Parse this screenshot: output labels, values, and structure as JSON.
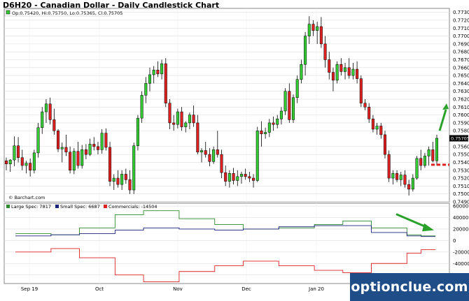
{
  "window": {
    "title": "D6H20 - Canadian Dollar - Daily Candlestick Chart"
  },
  "watermark": "optionclue.com",
  "chart_data": [
    {
      "type": "candlestick",
      "ohlc_legend": "Op:0.75420, Hi:0.75750, Lo:0.75365, Cl:0.75705",
      "credit": "© Barchart.com",
      "y_ticks": [
        "0.77300",
        "0.77200",
        "0.77100",
        "0.77000",
        "0.76900",
        "0.76800",
        "0.76700",
        "0.76600",
        "0.76500",
        "0.76400",
        "0.76300",
        "0.76200",
        "0.76100",
        "0.76000",
        "0.75900",
        "0.75800",
        "0.75600",
        "0.75500",
        "0.75400",
        "0.75300",
        "0.75200",
        "0.75100",
        "0.75000",
        "0.74900"
      ],
      "ylim": [
        0.749,
        0.7735
      ],
      "last_price_label": "0.75705",
      "last_price": 0.75705,
      "colors": {
        "up": "#33cc33",
        "down": "#e02020",
        "outline": "#000000"
      },
      "candles": [
        [
          0.7542,
          0.7546,
          0.753,
          0.7538
        ],
        [
          0.7538,
          0.7544,
          0.7528,
          0.7543
        ],
        [
          0.7543,
          0.7573,
          0.7535,
          0.7561
        ],
        [
          0.7561,
          0.7572,
          0.754,
          0.7546
        ],
        [
          0.7546,
          0.7556,
          0.753,
          0.7536
        ],
        [
          0.7536,
          0.7542,
          0.7526,
          0.7539
        ],
        [
          0.7539,
          0.7545,
          0.7522,
          0.753
        ],
        [
          0.753,
          0.7556,
          0.7526,
          0.7552
        ],
        [
          0.7552,
          0.759,
          0.7546,
          0.7584
        ],
        [
          0.7584,
          0.761,
          0.7576,
          0.7604
        ],
        [
          0.7604,
          0.762,
          0.759,
          0.7614
        ],
        [
          0.7614,
          0.7622,
          0.7588,
          0.7594
        ],
        [
          0.7594,
          0.7608,
          0.7575,
          0.758
        ],
        [
          0.758,
          0.7582,
          0.7553,
          0.7557
        ],
        [
          0.7557,
          0.7565,
          0.754,
          0.7559
        ],
        [
          0.7559,
          0.7575,
          0.7548,
          0.7553
        ],
        [
          0.7553,
          0.756,
          0.7526,
          0.753
        ],
        [
          0.753,
          0.7558,
          0.7525,
          0.7554
        ],
        [
          0.7554,
          0.7566,
          0.7532,
          0.7536
        ],
        [
          0.7536,
          0.7562,
          0.7532,
          0.7556
        ],
        [
          0.7556,
          0.7563,
          0.7544,
          0.755
        ],
        [
          0.755,
          0.757,
          0.7548,
          0.7563
        ],
        [
          0.7563,
          0.7572,
          0.7555,
          0.756
        ],
        [
          0.756,
          0.7566,
          0.755,
          0.7556
        ],
        [
          0.7556,
          0.7582,
          0.7551,
          0.7577
        ],
        [
          0.7577,
          0.7583,
          0.7555,
          0.7559
        ],
        [
          0.7559,
          0.7566,
          0.751,
          0.7516
        ],
        [
          0.7516,
          0.7525,
          0.7505,
          0.752
        ],
        [
          0.752,
          0.753,
          0.7508,
          0.7512
        ],
        [
          0.7512,
          0.753,
          0.7505,
          0.7525
        ],
        [
          0.7525,
          0.7532,
          0.7513,
          0.7518
        ],
        [
          0.7518,
          0.753,
          0.75,
          0.7505
        ],
        [
          0.7505,
          0.7565,
          0.75,
          0.7561
        ],
        [
          0.7561,
          0.76,
          0.7555,
          0.7596
        ],
        [
          0.7596,
          0.763,
          0.759,
          0.7625
        ],
        [
          0.7625,
          0.7648,
          0.7615,
          0.764
        ],
        [
          0.764,
          0.766,
          0.763,
          0.7651
        ],
        [
          0.7651,
          0.7662,
          0.764,
          0.7657
        ],
        [
          0.7657,
          0.7668,
          0.7648,
          0.7652
        ],
        [
          0.7652,
          0.767,
          0.7645,
          0.7665
        ],
        [
          0.7665,
          0.7672,
          0.761,
          0.7615
        ],
        [
          0.7615,
          0.762,
          0.7582,
          0.759
        ],
        [
          0.759,
          0.76,
          0.758,
          0.7588
        ],
        [
          0.7588,
          0.7608,
          0.7583,
          0.7604
        ],
        [
          0.7604,
          0.761,
          0.758,
          0.7585
        ],
        [
          0.7585,
          0.7592,
          0.7578,
          0.759
        ],
        [
          0.759,
          0.7603,
          0.7582,
          0.76
        ],
        [
          0.76,
          0.7612,
          0.7585,
          0.759
        ],
        [
          0.759,
          0.76,
          0.755,
          0.7553
        ],
        [
          0.7553,
          0.7558,
          0.754,
          0.7555
        ],
        [
          0.7555,
          0.7566,
          0.7546,
          0.755
        ],
        [
          0.755,
          0.7558,
          0.7535,
          0.7541
        ],
        [
          0.7541,
          0.756,
          0.7538,
          0.7556
        ],
        [
          0.7556,
          0.758,
          0.7546,
          0.755
        ],
        [
          0.755,
          0.7556,
          0.752,
          0.7527
        ],
        [
          0.7527,
          0.7536,
          0.751,
          0.7516
        ],
        [
          0.7516,
          0.753,
          0.7508,
          0.7526
        ],
        [
          0.7526,
          0.7533,
          0.7512,
          0.7517
        ],
        [
          0.7517,
          0.753,
          0.751,
          0.7522
        ],
        [
          0.7522,
          0.7528,
          0.7513,
          0.7525
        ],
        [
          0.7525,
          0.7532,
          0.7518,
          0.7522
        ],
        [
          0.7522,
          0.7528,
          0.7515,
          0.752
        ],
        [
          0.752,
          0.7525,
          0.7508,
          0.7517
        ],
        [
          0.7517,
          0.7585,
          0.7515,
          0.758
        ],
        [
          0.758,
          0.7592,
          0.756,
          0.7576
        ],
        [
          0.7576,
          0.7584,
          0.757,
          0.7578
        ],
        [
          0.7578,
          0.7595,
          0.7572,
          0.759
        ],
        [
          0.759,
          0.7598,
          0.758,
          0.7588
        ],
        [
          0.7588,
          0.76,
          0.7583,
          0.7595
        ],
        [
          0.7595,
          0.761,
          0.7588,
          0.7605
        ],
        [
          0.7605,
          0.7634,
          0.76,
          0.763
        ],
        [
          0.763,
          0.764,
          0.759,
          0.7594
        ],
        [
          0.7594,
          0.7626,
          0.759,
          0.7622
        ],
        [
          0.7622,
          0.765,
          0.7615,
          0.7645
        ],
        [
          0.7645,
          0.767,
          0.764,
          0.7664
        ],
        [
          0.7664,
          0.7705,
          0.765,
          0.77
        ],
        [
          0.77,
          0.7725,
          0.769,
          0.7715
        ],
        [
          0.7715,
          0.772,
          0.77,
          0.7707
        ],
        [
          0.7707,
          0.7718,
          0.769,
          0.7712
        ],
        [
          0.7712,
          0.7724,
          0.7685,
          0.769
        ],
        [
          0.769,
          0.77,
          0.766,
          0.767
        ],
        [
          0.767,
          0.768,
          0.7645,
          0.7654
        ],
        [
          0.7654,
          0.766,
          0.763,
          0.7644
        ],
        [
          0.7644,
          0.7668,
          0.764,
          0.7664
        ],
        [
          0.7664,
          0.7672,
          0.765,
          0.7655
        ],
        [
          0.7655,
          0.7666,
          0.7645,
          0.766
        ],
        [
          0.766,
          0.7672,
          0.7646,
          0.765
        ],
        [
          0.765,
          0.7666,
          0.7645,
          0.7658
        ],
        [
          0.7658,
          0.7668,
          0.764,
          0.7646
        ],
        [
          0.7646,
          0.765,
          0.761,
          0.7615
        ],
        [
          0.7615,
          0.762,
          0.7606,
          0.761
        ],
        [
          0.761,
          0.7615,
          0.759,
          0.7595
        ],
        [
          0.7595,
          0.76,
          0.7578,
          0.7582
        ],
        [
          0.7582,
          0.759,
          0.7575,
          0.7586
        ],
        [
          0.7586,
          0.759,
          0.757,
          0.7575
        ],
        [
          0.7575,
          0.758,
          0.7545,
          0.755
        ],
        [
          0.755,
          0.7555,
          0.7515,
          0.752
        ],
        [
          0.752,
          0.753,
          0.7512,
          0.7526
        ],
        [
          0.7526,
          0.753,
          0.7515,
          0.7518
        ],
        [
          0.7518,
          0.7528,
          0.751,
          0.7524
        ],
        [
          0.7524,
          0.753,
          0.7508,
          0.7512
        ],
        [
          0.7512,
          0.7518,
          0.7498,
          0.7506
        ],
        [
          0.7506,
          0.7525,
          0.7503,
          0.752
        ],
        [
          0.752,
          0.7548,
          0.7518,
          0.7545
        ],
        [
          0.7545,
          0.7556,
          0.753,
          0.7536
        ],
        [
          0.7536,
          0.7552,
          0.7533,
          0.7548
        ],
        [
          0.7548,
          0.756,
          0.7536,
          0.7556
        ],
        [
          0.7556,
          0.7566,
          0.754,
          0.7542
        ],
        [
          0.7542,
          0.7575,
          0.7536,
          0.75705
        ]
      ],
      "annotations": {
        "up_arrow": "green",
        "support_line": "red dashed"
      }
    },
    {
      "type": "line",
      "series": [
        {
          "name": "Large Spec: 7817",
          "color": "#2e8b2e"
        },
        {
          "name": "Small Spec: 6687",
          "color": "#1a237e"
        },
        {
          "name": "Commercials: -14504",
          "color": "#dd2222"
        }
      ],
      "y_ticks": [
        "60000",
        "40000",
        "20000",
        "0",
        "-20000",
        "-40000",
        "-60000"
      ],
      "ylim": [
        -75000,
        65000
      ],
      "x_labels": [
        "Sep 19",
        "Oct",
        "Nov",
        "Dec",
        "Jan 20"
      ],
      "values": {
        "large": [
          12000,
          12000,
          12000,
          12000,
          12000,
          10000,
          10000,
          10000,
          10000,
          22000,
          22000,
          22000,
          22000,
          22000,
          45000,
          45000,
          45000,
          45000,
          52000,
          52000,
          52000,
          52000,
          52000,
          38000,
          38000,
          38000,
          38000,
          38000,
          28000,
          28000,
          28000,
          28000,
          20000,
          20000,
          20000,
          20000,
          20000,
          22000,
          22000,
          22000,
          22000,
          22000,
          28000,
          28000,
          28000,
          28000,
          34000,
          34000,
          34000,
          34000,
          22000,
          22000,
          22000,
          22000,
          22000,
          10000,
          10000,
          8000,
          8000,
          8000
        ],
        "small": [
          8000,
          8000,
          8000,
          8000,
          8000,
          10000,
          10000,
          10000,
          10000,
          12000,
          12000,
          12000,
          12000,
          12000,
          18000,
          18000,
          18000,
          18000,
          22000,
          22000,
          22000,
          22000,
          22000,
          20000,
          20000,
          20000,
          20000,
          20000,
          18000,
          18000,
          18000,
          18000,
          20000,
          20000,
          20000,
          20000,
          20000,
          24000,
          24000,
          24000,
          24000,
          24000,
          26000,
          26000,
          26000,
          26000,
          26000,
          26000,
          26000,
          26000,
          14000,
          14000,
          14000,
          14000,
          14000,
          8000,
          8000,
          7000,
          7000,
          7000
        ],
        "comm": [
          -20000,
          -20000,
          -20000,
          -20000,
          -20000,
          -14000,
          -14000,
          -14000,
          -14000,
          -30000,
          -30000,
          -30000,
          -30000,
          -30000,
          -60000,
          -60000,
          -60000,
          -60000,
          -72000,
          -72000,
          -72000,
          -72000,
          -72000,
          -54000,
          -54000,
          -54000,
          -54000,
          -54000,
          -44000,
          -44000,
          -44000,
          -44000,
          -36000,
          -36000,
          -36000,
          -36000,
          -36000,
          -44000,
          -44000,
          -44000,
          -44000,
          -44000,
          -52000,
          -52000,
          -52000,
          -52000,
          -56000,
          -56000,
          -56000,
          -56000,
          -40000,
          -40000,
          -40000,
          -40000,
          -40000,
          -22000,
          -22000,
          -16000,
          -16000,
          -16000
        ]
      }
    }
  ]
}
